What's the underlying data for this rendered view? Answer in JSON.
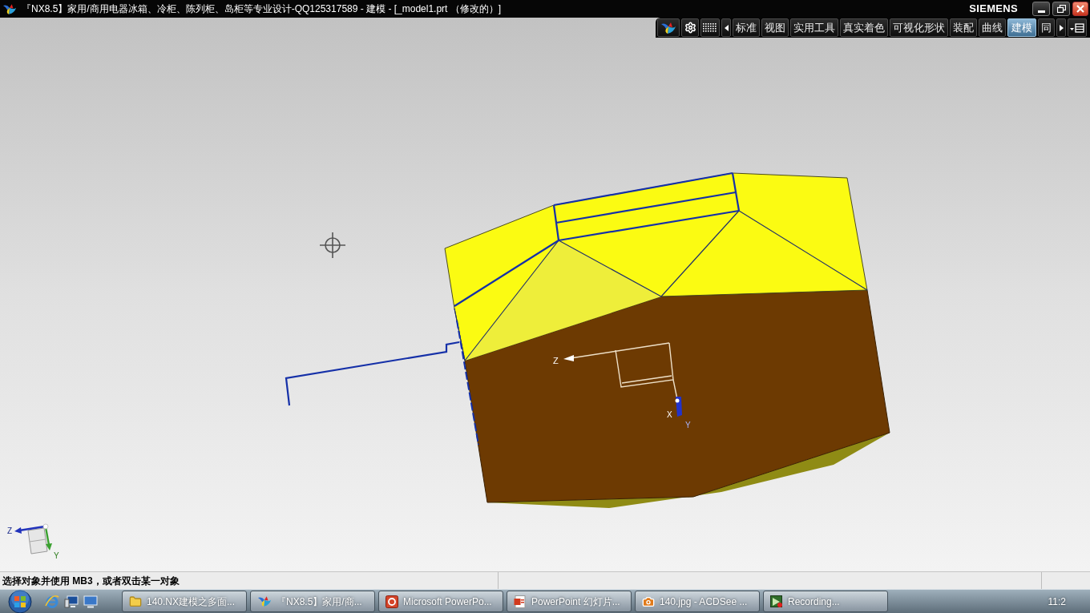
{
  "window": {
    "title": "『NX8.5】家用/商用电器冰箱、冷柜、陈列柜、岛柜等专业设计-QQ125317589 - 建模 - [_model1.prt （修改的）]",
    "brand": "SIEMENS"
  },
  "toolbar": {
    "tabs": [
      {
        "label": "标准",
        "selected": false
      },
      {
        "label": "视图",
        "selected": false
      },
      {
        "label": "实用工具",
        "selected": false
      },
      {
        "label": "真实着色",
        "selected": false
      },
      {
        "label": "可视化形状",
        "selected": false
      },
      {
        "label": "装配",
        "selected": false
      },
      {
        "label": "曲线",
        "selected": false
      },
      {
        "label": "建模",
        "selected": true
      },
      {
        "label": "同",
        "selected": false
      }
    ]
  },
  "viewport": {
    "work_csys": {
      "labels": [
        "Z",
        "X",
        "Y"
      ]
    },
    "view_triad": {
      "labels": [
        "Z",
        "Y"
      ]
    }
  },
  "status_bar": {
    "prompt": "选择对象并使用 MB3，或者双击某一对象"
  },
  "taskbar": {
    "buttons": [
      {
        "kind": "folder",
        "label": "140.NX建模之多面..."
      },
      {
        "kind": "app",
        "label": "『NX8.5】家用/商..."
      },
      {
        "kind": "presentation",
        "label": "Microsoft PowerPo..."
      },
      {
        "kind": "slideshow",
        "label": "PowerPoint 幻灯片..."
      },
      {
        "kind": "image-viewer",
        "label": "140.jpg - ACDSee ..."
      },
      {
        "kind": "recorder",
        "label": "Recording..."
      }
    ],
    "clock": "11:2"
  }
}
